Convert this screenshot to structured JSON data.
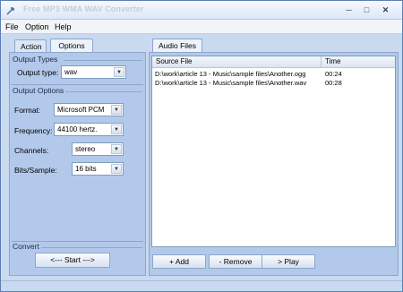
{
  "window": {
    "title": "Free MP3 WMA WAV Converter"
  },
  "menu": {
    "items": [
      "File",
      "Option",
      "Help"
    ]
  },
  "left_tabs": [
    {
      "label": "Action"
    },
    {
      "label": "Options"
    }
  ],
  "output_types": {
    "group_label": "Output Types",
    "type_label": "Output type:",
    "type_value": "wav"
  },
  "output_options": {
    "group_label": "Output Options",
    "format_label": "Format:",
    "format_value": "Microsoft PCM",
    "frequency_label": "Frequency:",
    "frequency_value": "44100 hertz.",
    "channels_label": "Channels:",
    "channels_value": "stereo",
    "bits_label": "Bits/Sample:",
    "bits_value": "16 bits"
  },
  "convert": {
    "group_label": "Convert",
    "start_label": "<--- Start --->"
  },
  "right_tab": {
    "label": "Audio Files"
  },
  "file_list": {
    "columns": [
      "Source File",
      "Time"
    ],
    "rows": [
      {
        "source": "D:\\work\\article 13 - Music\\sample files\\Another.ogg",
        "time": "00:24"
      },
      {
        "source": "D:\\work\\article 13 - Music\\sample files\\Another.wav",
        "time": "00:28"
      }
    ]
  },
  "actions": {
    "add_label": "+ Add",
    "remove_label": "- Remove",
    "play_label": "> Play"
  }
}
